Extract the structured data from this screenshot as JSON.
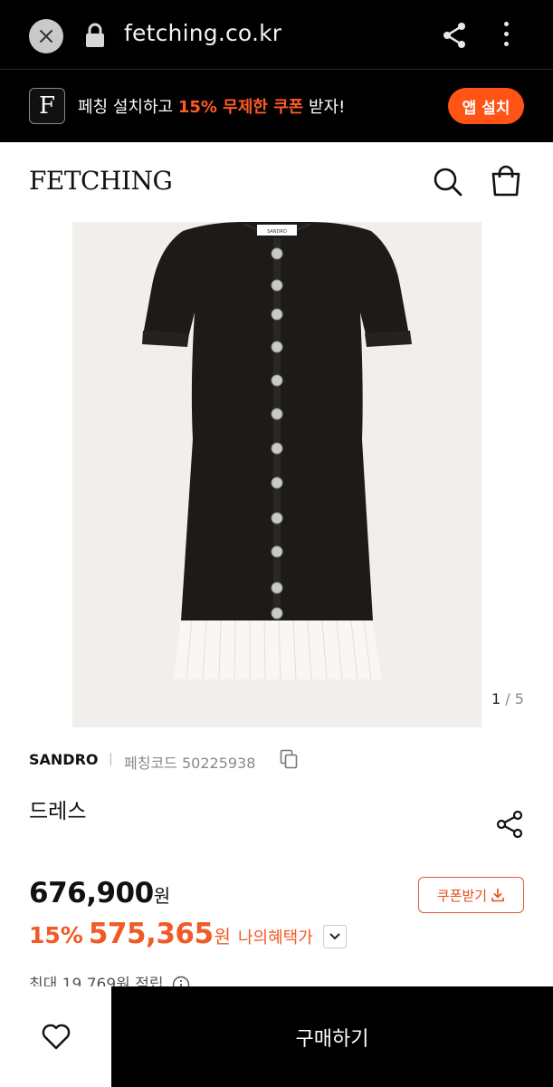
{
  "browser": {
    "url": "fetching.co.kr"
  },
  "promo": {
    "logo_letter": "F",
    "text_before": "페칭 설치하고 ",
    "text_highlight": "15% 무제한 쿠폰",
    "text_after": " 받자!",
    "install_label": "앱 설치",
    "accent": "#ff5416"
  },
  "header": {
    "logo": "FETCHING"
  },
  "gallery": {
    "current": "1",
    "separator": "/",
    "total": "5",
    "garment_label": "SANDRO"
  },
  "product": {
    "brand": "SANDRO",
    "code_label": "페칭코드 50225938",
    "name": "드레스"
  },
  "pricing": {
    "price": "676,900",
    "currency": "원",
    "coupon_label": "쿠폰받기",
    "discount_pct": "15%",
    "discount_price": "575,365",
    "benefit_label": "나의혜택가",
    "points": "최대 19,769원 적립",
    "discount_color": "#f05a24"
  },
  "actions": {
    "buy_label": "구매하기"
  },
  "icons": [
    "close-icon",
    "lock-icon",
    "share-icon",
    "more-vert-icon",
    "search-icon",
    "bag-icon",
    "copy-icon",
    "download-icon",
    "chevron-down-icon",
    "info-icon",
    "heart-icon"
  ]
}
